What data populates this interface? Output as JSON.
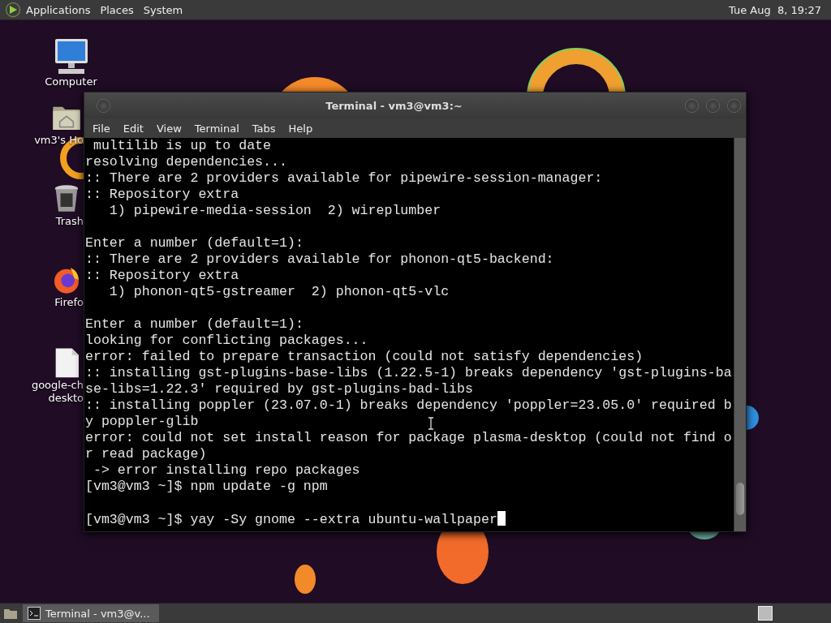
{
  "top_panel": {
    "menus": [
      "Applications",
      "Places",
      "System"
    ],
    "clock": "Tue Aug  8, 19:27"
  },
  "desktop_icons": [
    {
      "kind": "computer",
      "label_lines": [
        "Computer"
      ]
    },
    {
      "kind": "home",
      "label_lines": [
        "vm3's Ho"
      ]
    },
    {
      "kind": "trash",
      "label_lines": [
        "Trash"
      ]
    },
    {
      "kind": "browser",
      "label_lines": [
        "Firefo"
      ]
    },
    {
      "kind": "file",
      "label_lines": [
        "google-ch",
        "deskto"
      ]
    }
  ],
  "terminal": {
    "title": "Terminal - vm3@vm3:~",
    "menu": [
      "File",
      "Edit",
      "View",
      "Terminal",
      "Tabs",
      "Help"
    ],
    "lines": [
      {
        "kind": "text",
        "text": " multilib is up to date"
      },
      {
        "kind": "text",
        "text": "resolving dependencies..."
      },
      {
        "kind": "text",
        "text": ":: There are 2 providers available for pipewire-session-manager:"
      },
      {
        "kind": "text",
        "text": ":: Repository extra"
      },
      {
        "kind": "text",
        "text": "   1) pipewire-media-session  2) wireplumber"
      },
      {
        "kind": "blank"
      },
      {
        "kind": "text",
        "text": "Enter a number (default=1):"
      },
      {
        "kind": "text",
        "text": ":: There are 2 providers available for phonon-qt5-backend:"
      },
      {
        "kind": "text",
        "text": ":: Repository extra"
      },
      {
        "kind": "text",
        "text": "   1) phonon-qt5-gstreamer  2) phonon-qt5-vlc"
      },
      {
        "kind": "blank"
      },
      {
        "kind": "text",
        "text": "Enter a number (default=1):"
      },
      {
        "kind": "text",
        "text": "looking for conflicting packages..."
      },
      {
        "kind": "text",
        "text": "error: failed to prepare transaction (could not satisfy dependencies)"
      },
      {
        "kind": "text",
        "text": ":: installing gst-plugins-base-libs (1.22.5-1) breaks dependency 'gst-plugins-ba"
      },
      {
        "kind": "text",
        "text": "se-libs=1.22.3' required by gst-plugins-bad-libs"
      },
      {
        "kind": "text",
        "text": ":: installing poppler (23.07.0-1) breaks dependency 'poppler=23.05.0' required b"
      },
      {
        "kind": "text",
        "text": "y poppler-glib"
      },
      {
        "kind": "text",
        "text": "error: could not set install reason for package plasma-desktop (could not find o"
      },
      {
        "kind": "text",
        "text": "r read package)"
      },
      {
        "kind": "text",
        "text": " -> error installing repo packages"
      },
      {
        "kind": "text",
        "text": "[vm3@vm3 ~]$ npm update -g npm"
      },
      {
        "kind": "blank"
      },
      {
        "kind": "text",
        "text": "[vm3@vm3 ~]$ yay -Sy gnome --extra ubuntu-wallpaper"
      }
    ],
    "cursor": true
  },
  "taskbar": {
    "tasks": [
      {
        "label": "Terminal - vm3@v...",
        "selected": true
      }
    ]
  }
}
